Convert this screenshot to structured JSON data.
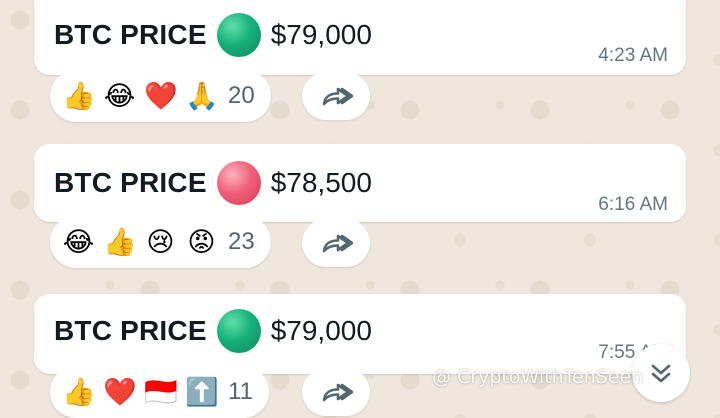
{
  "colors": {
    "chat_background": "#efe7dd",
    "bubble": "#ffffff",
    "up_indicator": "#17b07a",
    "down_indicator": "#f0607a",
    "timestamp": "#667781"
  },
  "messages": [
    {
      "label": "BTC PRICE",
      "indicator": "green-circle",
      "price": "$79,000",
      "time": "4:23 AM",
      "reactions": [
        "👍",
        "😂",
        "❤️",
        "🙏"
      ],
      "reaction_count": "20"
    },
    {
      "label": "BTC PRICE",
      "indicator": "red-circle",
      "price": "$78,500",
      "time": "6:16 AM",
      "reactions": [
        "😂",
        "👍",
        "😢",
        "😡"
      ],
      "reaction_count": "23"
    },
    {
      "label": "BTC PRICE",
      "indicator": "green-circle",
      "price": "$79,000",
      "time": "7:55 AM",
      "reactions": [
        "👍",
        "❤️",
        "🇮🇩",
        "⬆️"
      ],
      "reaction_count": "11"
    }
  ],
  "icons": {
    "forward": "forward-icon",
    "scroll_down": "double-chevron-down-icon"
  },
  "watermark": "@ CryptoWithTenSeen"
}
